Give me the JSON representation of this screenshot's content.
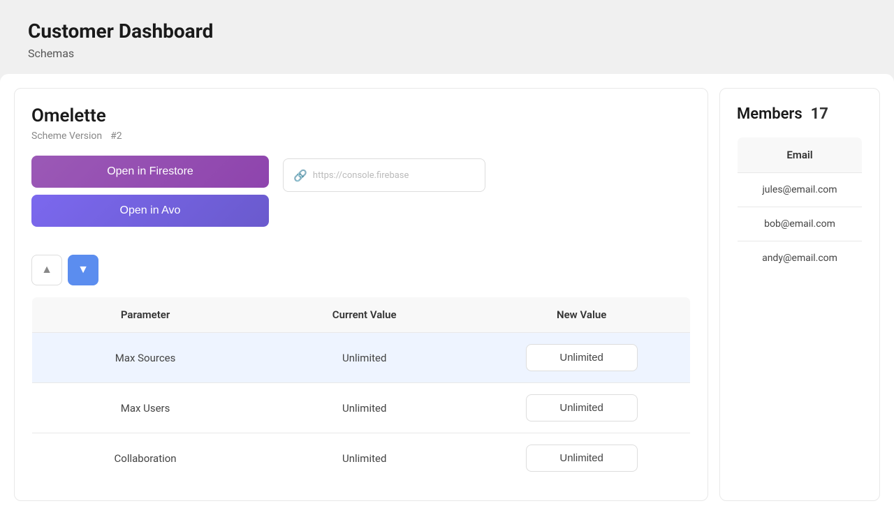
{
  "page": {
    "title": "Customer Dashboard",
    "subtitle": "Schemas"
  },
  "schema": {
    "name": "Omelette",
    "version_label": "Scheme Version",
    "version_value": "#2",
    "btn_firestore": "Open in Firestore",
    "btn_avo": "Open in Avo",
    "url_placeholder": "https://console.firebase",
    "table": {
      "col_parameter": "Parameter",
      "col_current": "Current Value",
      "col_new": "New Value",
      "rows": [
        {
          "parameter": "Max Sources",
          "current": "Unlimited",
          "new_value": "Unlimited",
          "highlighted": true
        },
        {
          "parameter": "Max Users",
          "current": "Unlimited",
          "new_value": "Unlimited",
          "highlighted": false
        },
        {
          "parameter": "Collaboration",
          "current": "Unlimited",
          "new_value": "Unlimited",
          "highlighted": false
        }
      ]
    }
  },
  "members": {
    "title": "Members",
    "count": "17",
    "col_email": "Email",
    "rows": [
      {
        "email": "jules@email.com"
      },
      {
        "email": "bob@email.com"
      },
      {
        "email": "andy@email.com"
      }
    ]
  },
  "icons": {
    "chevron_up": "▲",
    "chevron_down": "▼",
    "link": "🔗"
  }
}
